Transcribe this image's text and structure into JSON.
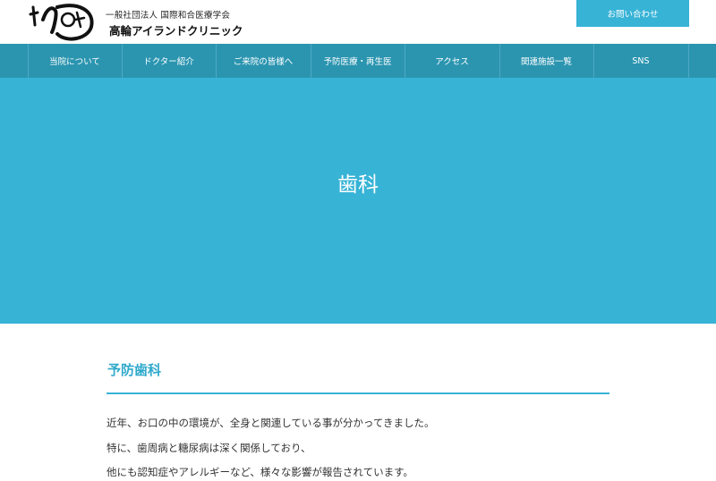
{
  "header": {
    "org_name": "一般社団法人 国際和合医療学会",
    "clinic_name": "高輪アイランドクリニック",
    "contact_label": "お問い合わせ",
    "logo_icon": "brush-calligraphy-logo"
  },
  "nav": {
    "items": [
      {
        "label": "当院について"
      },
      {
        "label": "ドクター紹介"
      },
      {
        "label": "ご来院の皆様へ"
      },
      {
        "label": "予防医療・再生医"
      },
      {
        "label": "アクセス"
      },
      {
        "label": "関連施設一覧"
      },
      {
        "label": "SNS"
      }
    ]
  },
  "hero": {
    "title": "歯科"
  },
  "content": {
    "section_title": "予防歯科",
    "paragraphs": [
      "近年、お口の中の環境が、全身と関連している事が分かってきました。",
      "特に、歯周病と糖尿病は深く関係しており、",
      "他にも認知症やアレルギーなど、様々な影響が報告されています。"
    ]
  },
  "colors": {
    "accent": "#37b3d6",
    "nav_bg": "#2b95b0",
    "heading": "#2fa9cc",
    "text": "#333333"
  }
}
